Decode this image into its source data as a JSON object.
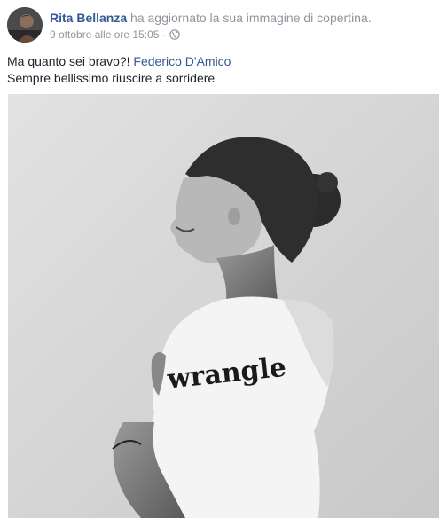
{
  "post": {
    "author": "Rita Bellanza",
    "action": "ha aggiornato la sua immagine di copertina.",
    "timestamp": "9 ottobre alle ore 15:05",
    "separator": "·",
    "privacy_icon": "globe-icon",
    "message_line1_prefix": "Ma quanto sei bravo?! ",
    "tagged_person": "Federico D'Amico",
    "message_line2": "Sempre bellissimo riuscire a sorridere",
    "photo_shirt_text": "wrangle"
  },
  "colors": {
    "link": "#365899",
    "secondary": "#90949c",
    "text": "#1d2129"
  }
}
